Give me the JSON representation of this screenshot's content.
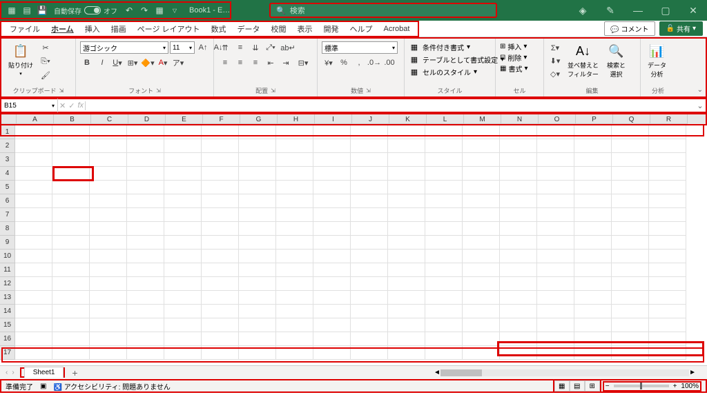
{
  "titlebar": {
    "autosave_label": "自動保存",
    "autosave_state": "オフ",
    "doc_title": "Book1 - E…",
    "search_placeholder": "検索"
  },
  "menu": {
    "items": [
      "ファイル",
      "ホーム",
      "挿入",
      "描画",
      "ページ レイアウト",
      "数式",
      "データ",
      "校閲",
      "表示",
      "開発",
      "ヘルプ",
      "Acrobat"
    ],
    "active_index": 1,
    "comment": "コメント",
    "share": "共有"
  },
  "ribbon": {
    "clipboard": {
      "paste": "貼り付け",
      "label": "クリップボード"
    },
    "font": {
      "name": "游ゴシック",
      "size": "11",
      "label": "フォント"
    },
    "align": {
      "label": "配置"
    },
    "number": {
      "format": "標準",
      "label": "数値"
    },
    "styles": {
      "cond": "条件付き書式",
      "table": "テーブルとして書式設定",
      "cell": "セルのスタイル",
      "label": "スタイル"
    },
    "cells": {
      "insert": "挿入",
      "delete": "削除",
      "format": "書式",
      "label": "セル"
    },
    "editing": {
      "sort": "並べ替えと\nフィルター",
      "find": "検索と\n選択",
      "label": "編集"
    },
    "analysis": {
      "btn": "データ\n分析",
      "label": "分析"
    }
  },
  "formula": {
    "namebox": "B15"
  },
  "columns": [
    "A",
    "B",
    "C",
    "D",
    "E",
    "F",
    "G",
    "H",
    "I",
    "J",
    "K",
    "L",
    "M",
    "N",
    "O",
    "P",
    "Q",
    "R"
  ],
  "rows": [
    "1",
    "2",
    "3",
    "4",
    "5",
    "6",
    "7",
    "8",
    "9",
    "10",
    "11",
    "12",
    "13",
    "14",
    "15",
    "16",
    "17"
  ],
  "sheets": {
    "active": "Sheet1"
  },
  "status": {
    "ready": "準備完了",
    "accessibility": "アクセシビリティ: 問題ありません",
    "zoom": "100%"
  }
}
